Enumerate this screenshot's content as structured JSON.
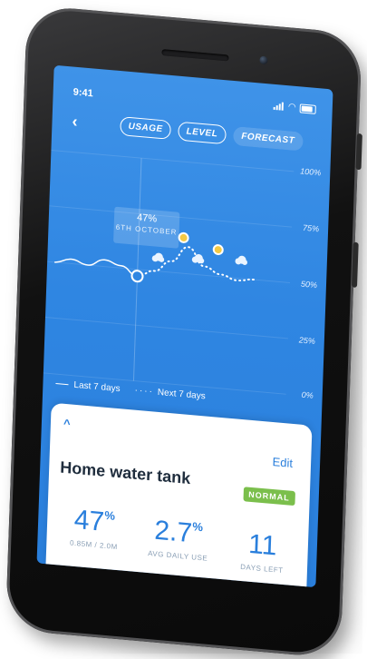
{
  "status_bar": {
    "time": "9:41"
  },
  "header": {
    "back_glyph": "‹",
    "tabs": [
      {
        "label": "USAGE",
        "active": false
      },
      {
        "label": "LEVEL",
        "active": false
      },
      {
        "label": "FORECAST",
        "active": true
      }
    ]
  },
  "chart_data": {
    "type": "line",
    "y_labels": [
      "100%",
      "75%",
      "50%",
      "25%",
      "0%"
    ],
    "ylim": [
      0,
      100
    ],
    "series": [
      {
        "name": "Last 7 days",
        "style": "solid",
        "x": [
          0,
          1,
          2,
          3,
          4,
          5
        ],
        "values": [
          50,
          52,
          50,
          53,
          51,
          47
        ]
      },
      {
        "name": "Next 7 days",
        "style": "dotted",
        "x": [
          5,
          6,
          7,
          8,
          9,
          10,
          11,
          12
        ],
        "values": [
          47,
          50,
          55,
          62,
          54,
          51,
          49,
          50
        ]
      }
    ],
    "selected_point": {
      "value": "47%",
      "label": "6TH OCTOBER"
    },
    "weather_icons": [
      "cloud-icon",
      "sun-icon",
      "cloud-icon",
      "sun-icon",
      "cloud-icon"
    ],
    "legend": [
      {
        "label": "Last 7 days",
        "style": "solid"
      },
      {
        "label": "Next 7 days",
        "style": "dotted"
      }
    ]
  },
  "card": {
    "edit_label": "Edit",
    "title": "Home water tank",
    "badge": "NORMAL",
    "stats": [
      {
        "value": "47",
        "unit": "%",
        "caption": "0.85M / 2.0M"
      },
      {
        "value": "2.7",
        "unit": "%",
        "caption": "AVG DAILY USE"
      },
      {
        "value": "11",
        "unit": "",
        "caption": "DAYS LEFT"
      }
    ]
  },
  "colors": {
    "accent": "#2a7fdc",
    "badge": "#7bbf4c",
    "sun": "#f3c944"
  }
}
